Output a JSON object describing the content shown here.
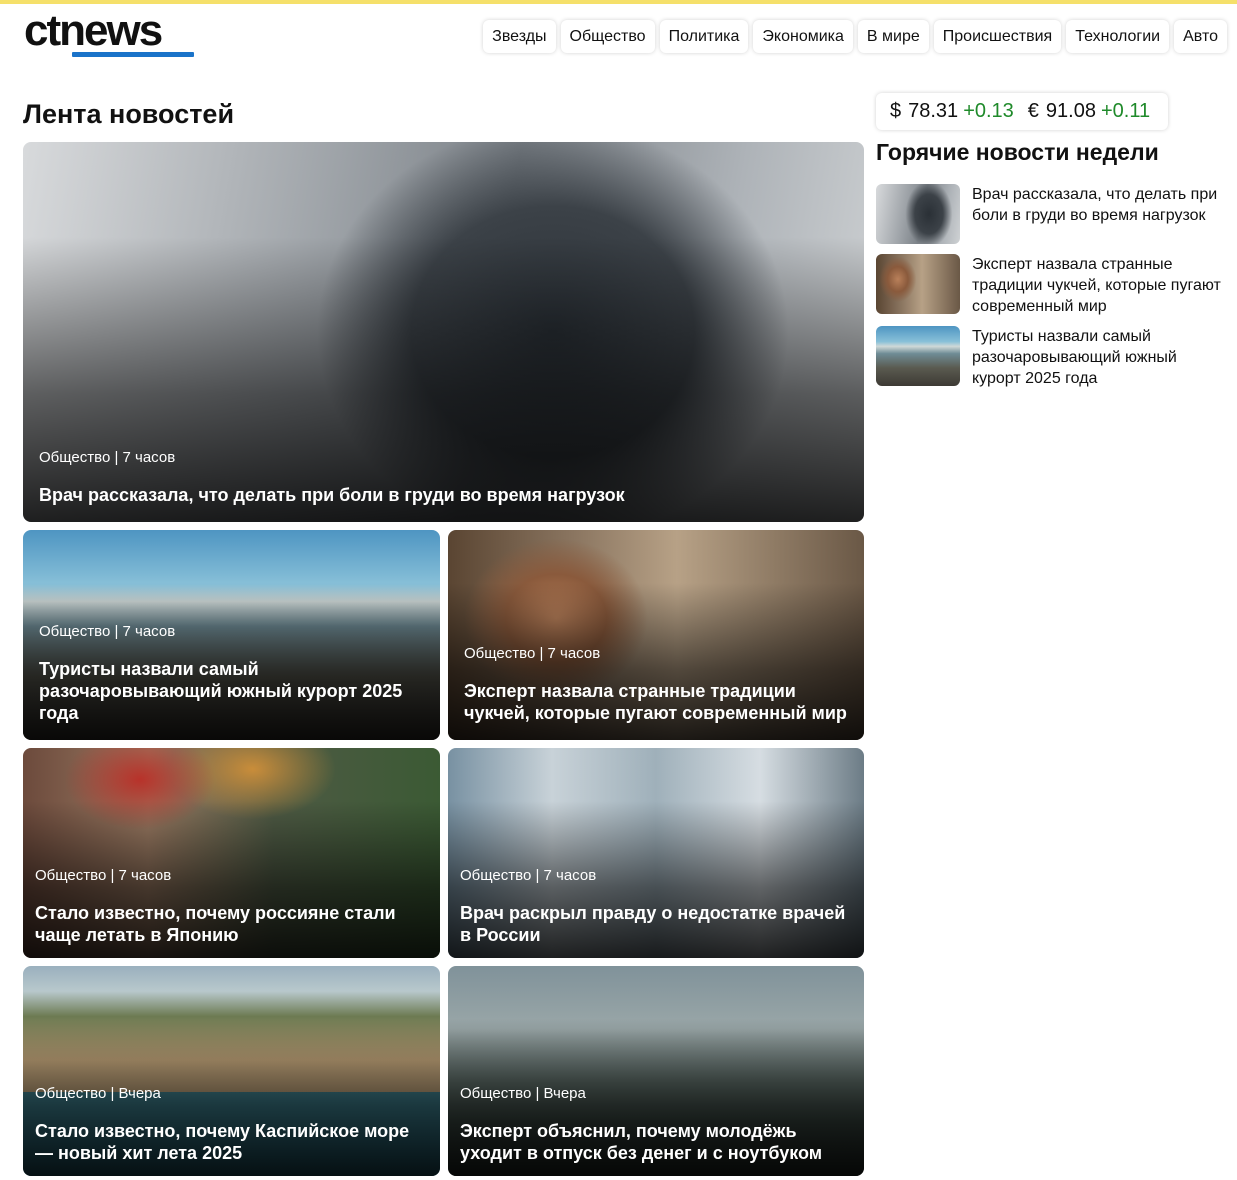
{
  "site": {
    "logo": "ctnews",
    "accent_color": "#1a73c9",
    "topline_color": "#f5e06a"
  },
  "nav": {
    "items": [
      "Звезды",
      "Общество",
      "Политика",
      "Экономика",
      "В мире",
      "Происшествия",
      "Технологии",
      "Авто"
    ]
  },
  "feed": {
    "title": "Лента новостей",
    "cards": [
      {
        "meta": "Общество | 7 часов",
        "title": "Врач рассказала, что делать при боли в груди во время нагрузок",
        "photo": "woman-at-gym-photo"
      },
      {
        "meta": "Общество | 7 часов",
        "title": "Туристы назвали самый разочаровывающий южный курорт 2025 года",
        "photo": "seaside-promenade-photo"
      },
      {
        "meta": "Общество | 7 часов",
        "title": "Эксперт назвала странные традиции чукчей, которые пугают современный мир",
        "photo": "chukchi-woman-photo"
      },
      {
        "meta": "Общество | 7 часов",
        "title": "Стало известно, почему россияне стали чаще летать в Японию",
        "photo": "tourists-in-japan-photo"
      },
      {
        "meta": "Общество | 7 часов",
        "title": "Врач раскрыл правду о недостатке врачей в России",
        "photo": "doctors-photo"
      },
      {
        "meta": "Общество | Вчера",
        "title": "Стало известно, почему Каспийское море — новый хит лета 2025",
        "photo": "caspian-beach-photo"
      },
      {
        "meta": "Общество | Вчера",
        "title": "Эксперт объяснил, почему молодёжь уходит в отпуск без денег и с ноутбуком",
        "photo": "tent-by-lake-photo"
      }
    ]
  },
  "rates": {
    "usd": {
      "symbol": "$",
      "value": "78.31",
      "change": "+0.13"
    },
    "eur": {
      "symbol": "€",
      "value": "91.08",
      "change": "+0.11"
    },
    "positive_color": "#1f8a2a"
  },
  "hot": {
    "title": "Горячие новости недели",
    "items": [
      {
        "text": "Врач рассказала, что делать при боли в груди во время нагрузок"
      },
      {
        "text": "Эксперт назвала странные традиции чукчей, которые пугают современный мир"
      },
      {
        "text": "Туристы назвали самый разочаровывающий южный курорт 2025 года"
      }
    ]
  }
}
